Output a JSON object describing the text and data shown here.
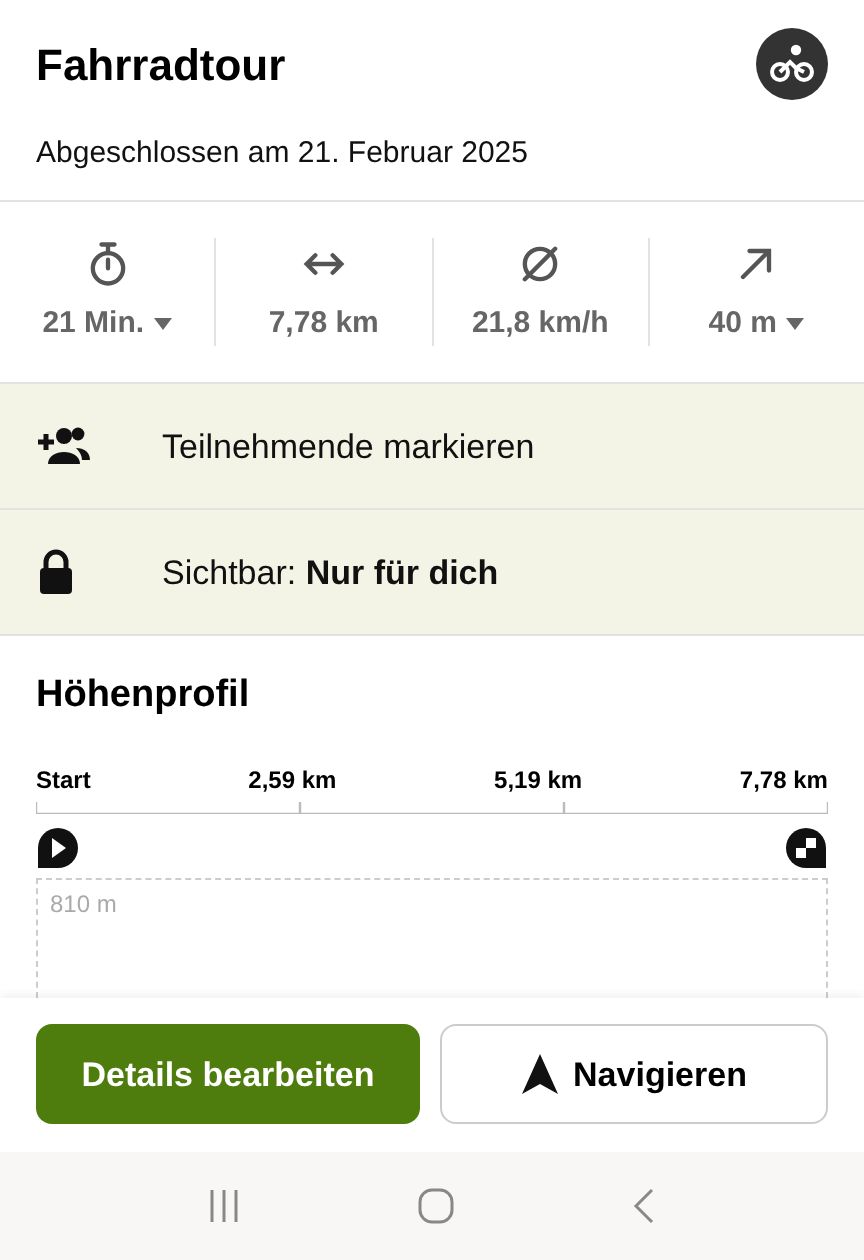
{
  "header": {
    "title": "Fahrradtour",
    "subtitle": "Abgeschlossen am 21. Februar 2025"
  },
  "stats": [
    {
      "kind": "duration",
      "value": "21 Min.",
      "dropdown": true
    },
    {
      "kind": "distance",
      "value": "7,78 km",
      "dropdown": false
    },
    {
      "kind": "speed",
      "value": "21,8 km/h",
      "dropdown": false
    },
    {
      "kind": "ascent",
      "value": "40 m",
      "dropdown": true
    }
  ],
  "rows": [
    {
      "kind": "participants",
      "text": "Teilnehmende markieren"
    },
    {
      "kind": "visibility",
      "text": "Sichtbar: **Nur für dich**"
    }
  ],
  "elevation_profile": {
    "title": "Höhenprofil",
    "axis_labels": [
      "Start",
      "2,59 km",
      "5,19 km",
      "7,78 km"
    ],
    "y_label": "810 m"
  },
  "buttons": [
    {
      "kind": "primary",
      "label": "Details bearbeiten"
    },
    {
      "kind": "navigate",
      "label": "Navigieren"
    }
  ]
}
